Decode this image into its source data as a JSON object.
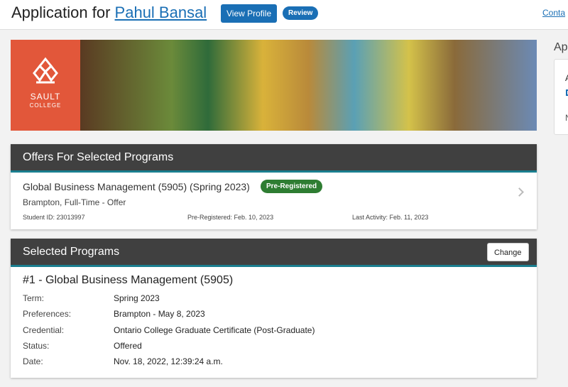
{
  "header": {
    "title_prefix": "Application for",
    "applicant_name": "Pahul Bansal",
    "view_profile_label": "View Profile",
    "status_pill": "Review",
    "contact_link": "Conta"
  },
  "banner": {
    "logo_line1": "SAULT",
    "logo_line2": "COLLEGE",
    "logo_color": "#e2573a"
  },
  "sidebar": {
    "heading": "Ap",
    "line1": "A",
    "line3": "N"
  },
  "offers": {
    "heading": "Offers For Selected Programs",
    "program": "Global Business Management (5905) (Spring 2023)",
    "badge": "Pre-Registered",
    "location": "Brampton, Full-Time - Offer",
    "student_id": "Student ID: 23013997",
    "pre_registered": "Pre-Registered: Feb. 10, 2023",
    "last_activity": "Last Activity: Feb. 11, 2023"
  },
  "selected": {
    "heading": "Selected Programs",
    "change_label": "Change",
    "program_title": "#1 - Global Business Management (5905)",
    "rows": [
      {
        "label": "Term:",
        "value": "Spring 2023"
      },
      {
        "label": "Preferences:",
        "value": "Brampton - May 8, 2023"
      },
      {
        "label": "Credential:",
        "value": "Ontario College Graduate Certificate (Post-Graduate)"
      },
      {
        "label": "Status:",
        "value": "Offered"
      },
      {
        "label": "Date:",
        "value": "Nov. 18, 2022, 12:39:24 a.m."
      }
    ]
  },
  "colors": {
    "accent": "#1a6fb5",
    "header_bar": "#404040",
    "teal_rule": "#1a7e8f",
    "success": "#2e7d32"
  }
}
